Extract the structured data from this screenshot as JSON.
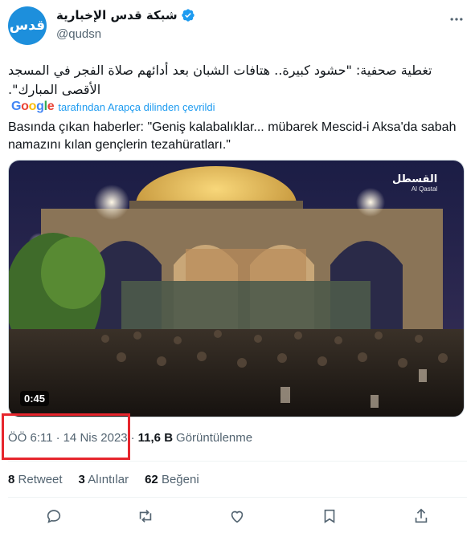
{
  "author": {
    "avatar_text": "قدس",
    "display_name": "شبكة قدس الإخبارية",
    "handle": "@qudsn",
    "verified_icon": "verified-badge-icon"
  },
  "tweet": {
    "original_text": "تغطية صحفية: \"حشود كبيرة.. هتافات الشبان بعد أدائهم صلاة الفجر في المسجد الأقصى المبارك\".",
    "translation_brand": "Google",
    "translation_note": "tarafından Arapça dilinden çevrildi",
    "translated_text": "Basında çıkan haberler: \"Geniş kalabalıklar... mübarek Mescid-i Aksa'da sabah namazını kılan gençlerin tezahüratları.\""
  },
  "media": {
    "duration": "0:45",
    "watermark_ar": "القسطل",
    "watermark_en": "Al Qastal"
  },
  "meta": {
    "time": "ÖÖ 6:11",
    "separator": "·",
    "date": "14 Nis 2023",
    "views_count": "11,6 B",
    "views_label": "Görüntülenme"
  },
  "stats": {
    "retweets_count": "8",
    "retweets_label": "Retweet",
    "quotes_count": "3",
    "quotes_label": "Alıntılar",
    "likes_count": "62",
    "likes_label": "Beğeni"
  },
  "colors": {
    "accent": "#1d9bf0",
    "highlight_box": "#e6262d"
  }
}
